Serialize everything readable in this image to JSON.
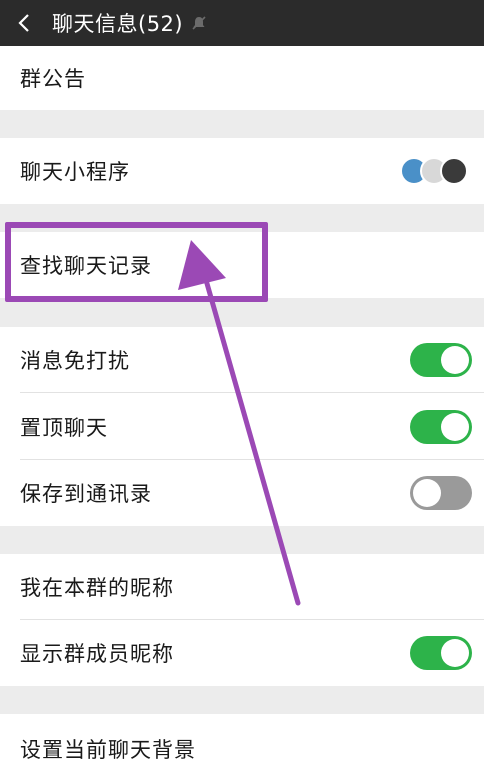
{
  "header": {
    "title": "聊天信息(52)",
    "back_icon": "chevron-left-icon",
    "mute_icon": "bell-off-icon"
  },
  "items": {
    "announcement": "群公告",
    "mini_programs": "聊天小程序",
    "search_history": "查找聊天记录",
    "mute_notifications": {
      "label": "消息免打扰",
      "on": true
    },
    "pin_chat": {
      "label": "置顶聊天",
      "on": true
    },
    "save_contacts": {
      "label": "保存到通讯录",
      "on": false
    },
    "my_nickname": "我在本群的昵称",
    "show_nicknames": {
      "label": "显示群成员昵称",
      "on": true
    },
    "chat_background": "设置当前聊天背景"
  },
  "colors": {
    "toggle_on": "#2db34a",
    "toggle_off": "#9a9a9a",
    "annotation": "#9b49b5",
    "header_bg": "#2b2b2b"
  }
}
